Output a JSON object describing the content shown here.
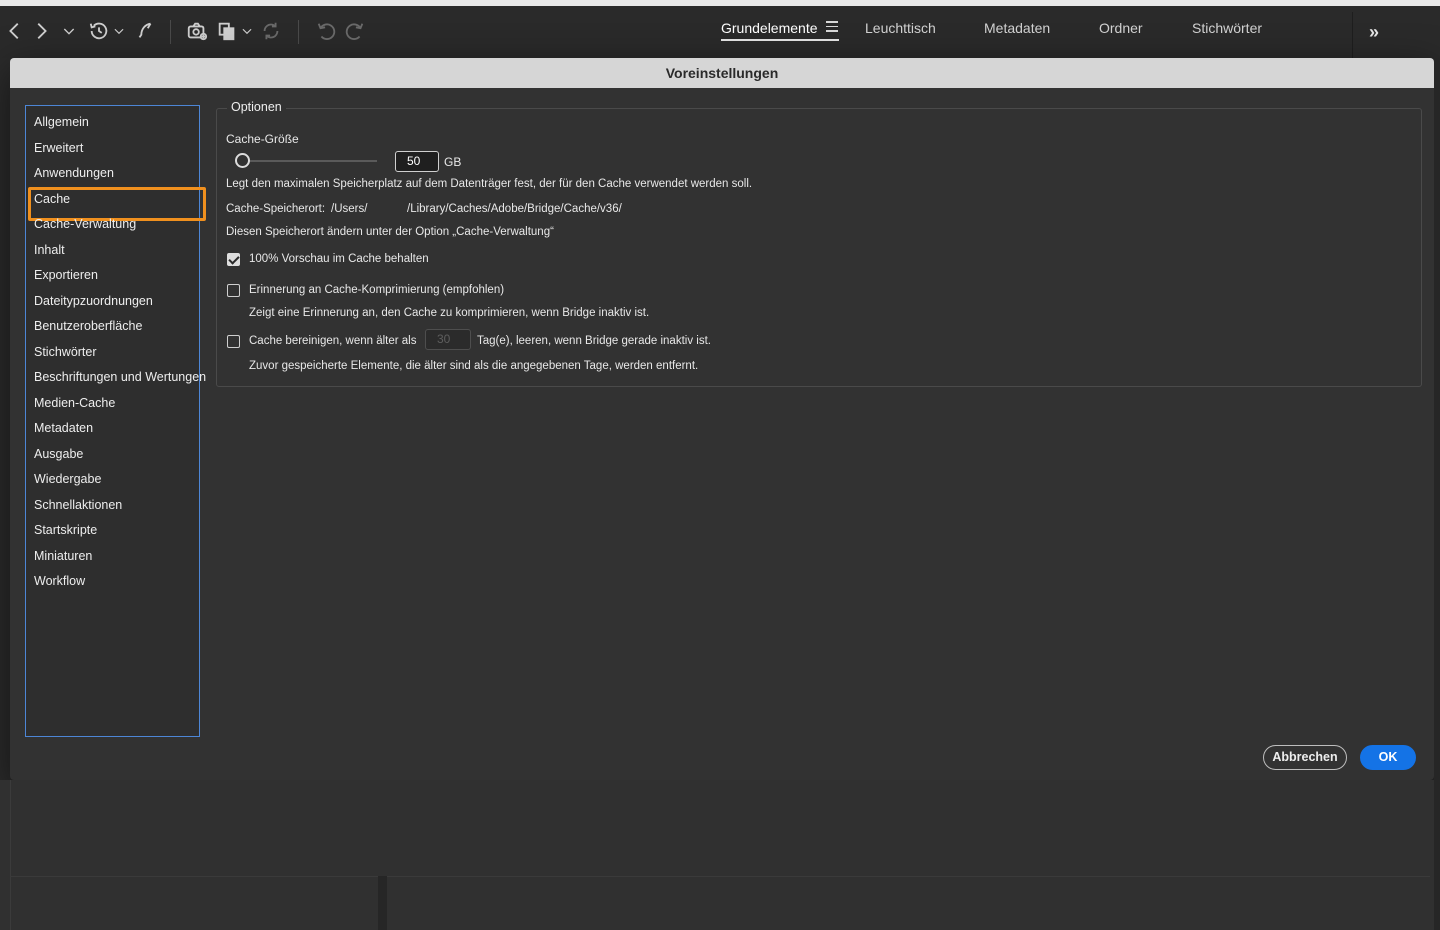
{
  "toolbar": {
    "icons": [
      "back-icon",
      "forward-icon",
      "dropdown-chevron-icon",
      "recent-history-icon",
      "boomerang-icon",
      "camera-import-icon",
      "copy-files-icon",
      "refresh-icon",
      "rotate-left-icon",
      "rotate-right-icon"
    ],
    "workspaces": [
      "Grundelemente",
      "Leuchttisch",
      "Metadaten",
      "Ordner",
      "Stichwörter"
    ],
    "active_workspace": "Grundelemente",
    "more_label": "»"
  },
  "dialog": {
    "title": "Voreinstellungen",
    "categories": [
      "Allgemein",
      "Erweitert",
      "Anwendungen",
      "Cache",
      "Cache-Verwaltung",
      "Inhalt",
      "Exportieren",
      "Dateitypzuordnungen",
      "Benutzeroberfläche",
      "Stichwörter",
      "Beschriftungen und Wertungen",
      "Medien-Cache",
      "Metadaten",
      "Ausgabe",
      "Wiedergabe",
      "Schnellaktionen",
      "Startskripte",
      "Miniaturen",
      "Workflow"
    ],
    "selected_category": "Cache",
    "options": {
      "legend": "Optionen",
      "cache_size_label": "Cache-Größe",
      "cache_size_value": "50",
      "cache_size_unit": "GB",
      "cache_size_desc": "Legt den maximalen Speicherplatz auf dem Datenträger fest, der für den Cache verwendet werden soll.",
      "location_label": "Cache-Speicherort:",
      "location_prefix": "/Users/",
      "location_suffix": "/Library/Caches/Adobe/Bridge/Cache/v36/",
      "location_hint": "Diesen Speicherort ändern unter der Option „Cache-Verwaltung“",
      "keep_preview_label": "100% Vorschau im Cache behalten",
      "keep_preview_checked": true,
      "compress_reminder_label": "Erinnerung an Cache-Komprimierung (empfohlen)",
      "compress_reminder_checked": false,
      "compress_reminder_desc": "Zeigt eine Erinnerung an, den Cache zu komprimieren, wenn Bridge inaktiv ist.",
      "purge_label_pre": "Cache bereinigen, wenn älter als",
      "purge_days": "30",
      "purge_label_post": "Tag(e), leeren, wenn Bridge gerade inaktiv ist.",
      "purge_checked": false,
      "purge_desc": "Zuvor gespeicherte Elemente, die älter sind als die angegebenen Tage, werden entfernt."
    },
    "buttons": {
      "cancel": "Abbrechen",
      "ok": "OK"
    }
  }
}
